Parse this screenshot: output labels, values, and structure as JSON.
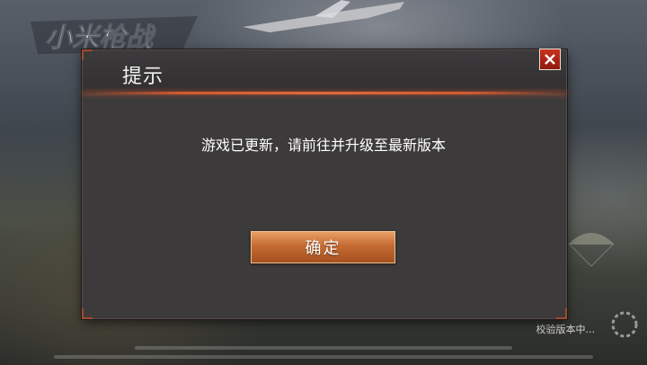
{
  "background": {
    "game_logo": "小米枪战",
    "status_text": "校验版本中...",
    "icons": [
      "plane-icon",
      "parachute-icon",
      "loading-spinner-icon"
    ]
  },
  "dialog": {
    "title": "提示",
    "message": "游戏已更新，请前往并升级至最新版本",
    "confirm_label": "确定",
    "close_icon": "close-icon"
  },
  "colors": {
    "dialog_bg": "#3d3a3b",
    "accent_line": "#e06a3a",
    "close_red": "#c8321d",
    "button_orange": "#c56a32"
  }
}
